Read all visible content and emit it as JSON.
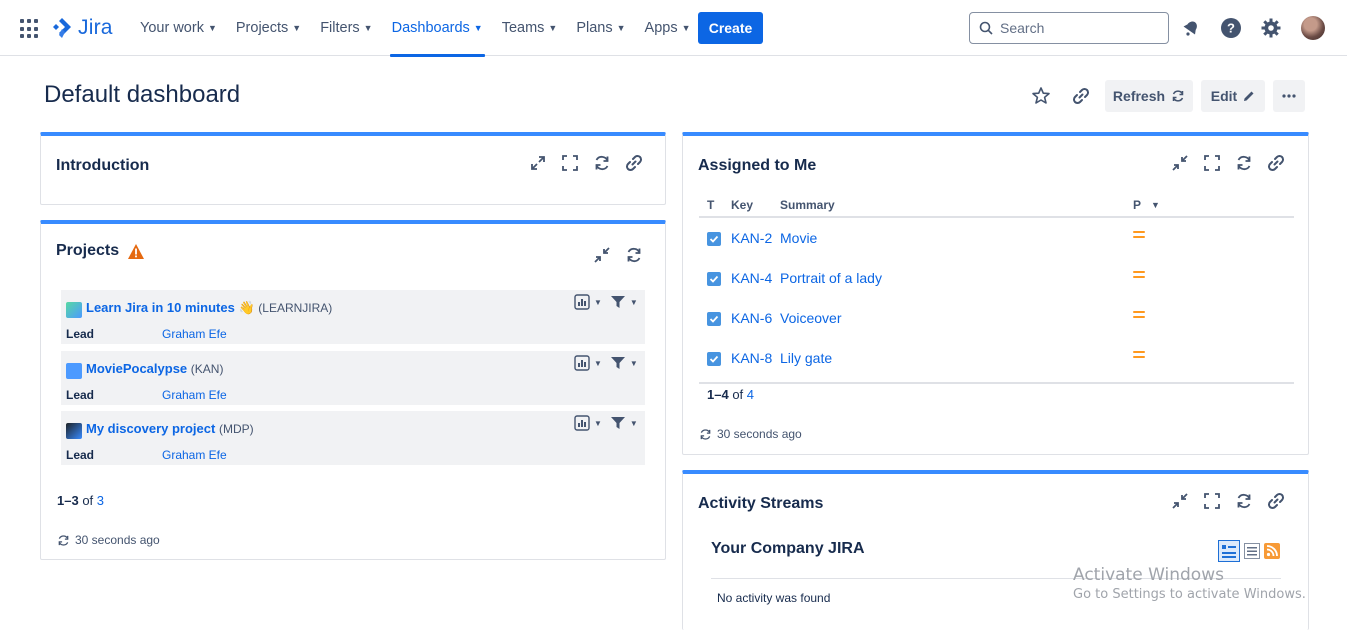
{
  "app": {
    "name": "Jira"
  },
  "nav": {
    "items": [
      {
        "label": "Your work"
      },
      {
        "label": "Projects"
      },
      {
        "label": "Filters"
      },
      {
        "label": "Dashboards"
      },
      {
        "label": "Teams"
      },
      {
        "label": "Plans"
      },
      {
        "label": "Apps"
      }
    ],
    "active": "Dashboards",
    "create_label": "Create",
    "search_placeholder": "Search"
  },
  "header": {
    "title": "Default dashboard",
    "refresh_label": "Refresh",
    "edit_label": "Edit"
  },
  "introduction": {
    "title": "Introduction"
  },
  "projects": {
    "title": "Projects",
    "lead_label": "Lead",
    "items": [
      {
        "name": "Learn Jira in 10 minutes",
        "key": "(LEARNJIRA)",
        "lead": "Graham Efe"
      },
      {
        "name": "MoviePocalypse",
        "key": "(KAN)",
        "lead": "Graham Efe"
      },
      {
        "name": "My discovery project",
        "key": "(MDP)",
        "lead": "Graham Efe"
      }
    ],
    "count_range": "1–3",
    "count_of": "of",
    "count_total": "3",
    "updated": "30 seconds ago"
  },
  "assigned": {
    "title": "Assigned to Me",
    "columns": {
      "t": "T",
      "key": "Key",
      "summary": "Summary",
      "p": "P"
    },
    "rows": [
      {
        "key": "KAN-2",
        "summary": "Movie"
      },
      {
        "key": "KAN-4",
        "summary": "Portrait of a lady"
      },
      {
        "key": "KAN-6",
        "summary": "Voiceover"
      },
      {
        "key": "KAN-8",
        "summary": "Lily gate"
      }
    ],
    "count_range": "1–4",
    "count_of": "of",
    "count_total": "4",
    "updated": "30 seconds ago"
  },
  "activity": {
    "title": "Activity Streams",
    "stream_title": "Your Company JIRA",
    "empty": "No activity was found"
  },
  "watermark": {
    "line1": "Activate Windows",
    "line2": "Go to Settings to activate Windows."
  },
  "colors": {
    "accent": "#0c66e4",
    "gadget_border": "#388bff",
    "priority_medium": "#ff991f"
  }
}
